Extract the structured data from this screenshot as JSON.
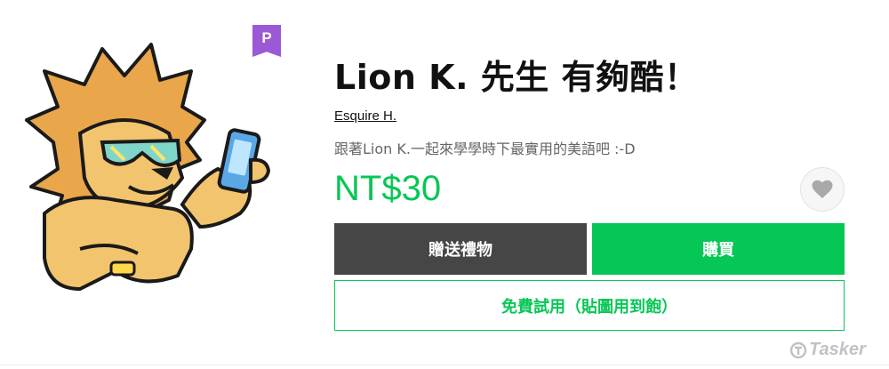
{
  "sticker": {
    "badge_letter": "P",
    "title": "Lion K. 先生 有夠酷！",
    "author": "Esquire H.",
    "description": "跟著Lion K.一起來學學時下最實用的美語吧 :-D",
    "price": "NT$30",
    "favorite_icon": "heart-icon"
  },
  "actions": {
    "gift_label": "贈送禮物",
    "buy_label": "購買",
    "trial_label": "免費試用（貼圖用到飽）"
  },
  "watermark": {
    "text": "Tasker"
  },
  "colors": {
    "brand_green": "#06c755",
    "gift_gray": "#464646",
    "premium_purple": "#9b59d6",
    "lion_orange": "#e9a64a"
  }
}
